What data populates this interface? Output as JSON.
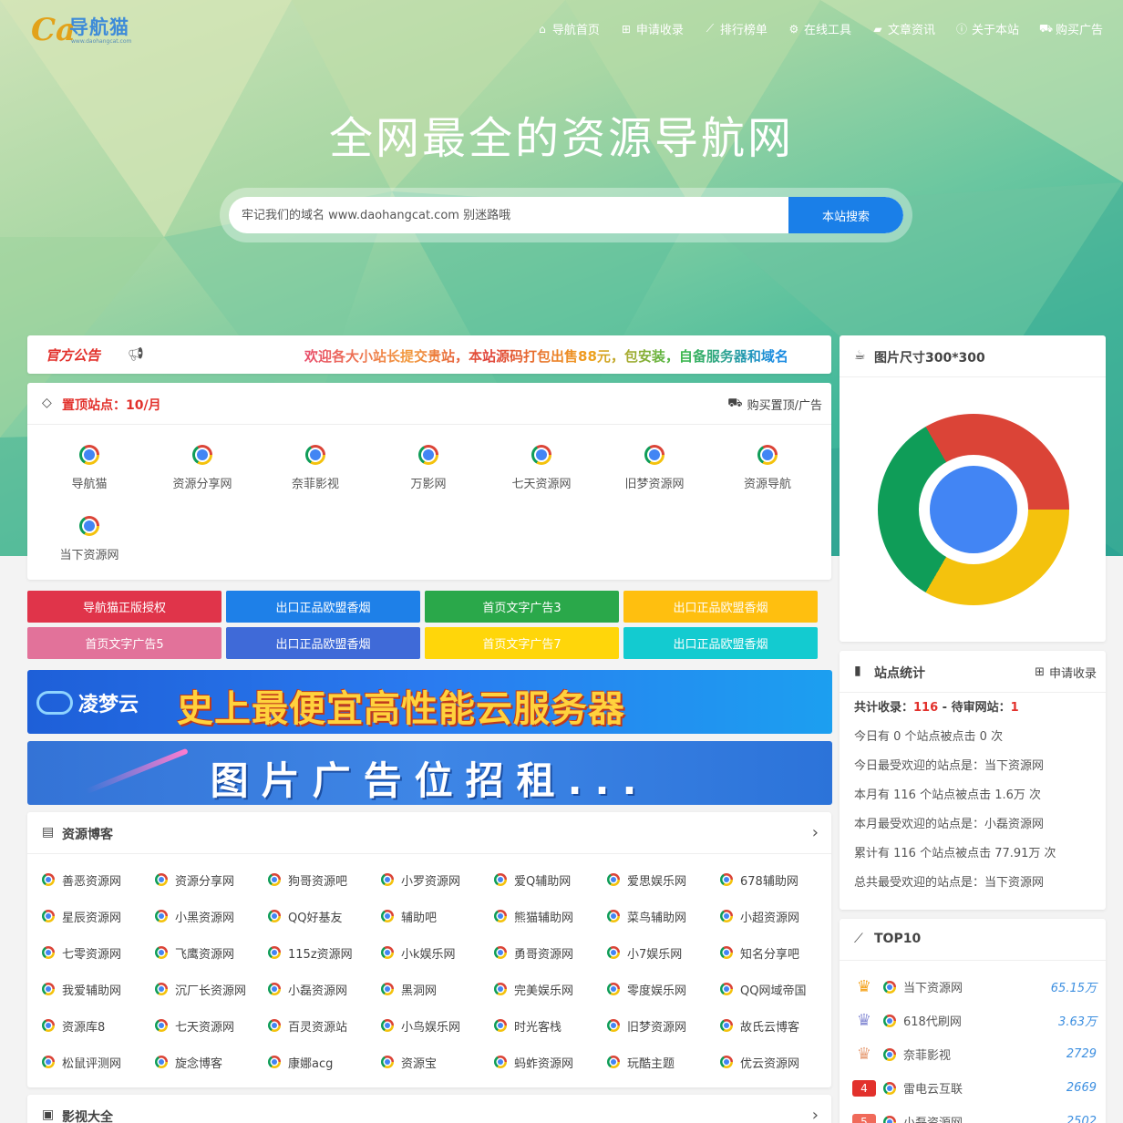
{
  "header": {
    "logo_text": "导航猫",
    "logo_sub": "www.daohangcat.com",
    "nav": [
      {
        "label": "导航首页",
        "icon": "home-icon",
        "glyph": "⌂"
      },
      {
        "label": "申请收录",
        "icon": "plus-square-icon",
        "glyph": "⊞"
      },
      {
        "label": "排行榜单",
        "icon": "line-chart-icon",
        "glyph": "⟋"
      },
      {
        "label": "在线工具",
        "icon": "gears-icon",
        "glyph": "⚙"
      },
      {
        "label": "文章资讯",
        "icon": "folder-open-icon",
        "glyph": "▰"
      },
      {
        "label": "关于本站",
        "icon": "info-circle-icon",
        "glyph": "ⓘ"
      },
      {
        "label": "购买广告",
        "icon": "cart-icon",
        "glyph": "⛟"
      }
    ]
  },
  "hero": {
    "title": "全网最全的资源导航网",
    "search_placeholder": "牢记我们的域名 www.daohangcat.com 别迷路哦",
    "search_button": "本站搜索"
  },
  "notice": {
    "label": "官方公告",
    "text": "欢迎各大小站长提交贵站，本站源码打包出售88元，包安装，自备服务器和域名"
  },
  "pinned": {
    "title": "置顶站点：10/月",
    "buy_label": "购买置顶/广告",
    "items": [
      "导航猫",
      "资源分享网",
      "奈菲影视",
      "万影网",
      "七天资源网",
      "旧梦资源网",
      "资源导航",
      "当下资源网"
    ]
  },
  "text_ads": [
    {
      "label": "导航猫正版授权",
      "color": "#e0344a"
    },
    {
      "label": "出口正品欧盟香烟",
      "color": "#1e80e8"
    },
    {
      "label": "首页文字广告3",
      "color": "#2aa84a"
    },
    {
      "label": "出口正品欧盟香烟",
      "color": "#ffbf0f"
    },
    {
      "label": "首页文字广告5",
      "color": "#e2729a"
    },
    {
      "label": "出口正品欧盟香烟",
      "color": "#3f6ad8"
    },
    {
      "label": "首页文字广告7",
      "color": "#ffd60a"
    },
    {
      "label": "出口正品欧盟香烟",
      "color": "#13cbd0"
    }
  ],
  "banners": {
    "b1_logo": "凌梦云",
    "b1_text": "史上最便宜高性能云服务器",
    "b2_text": "图片广告位招租..."
  },
  "blog": {
    "title": "资源博客",
    "sites": [
      "善恶资源网",
      "资源分享网",
      "狗哥资源吧",
      "小罗资源网",
      "爱Q辅助网",
      "爱思娱乐网",
      "678辅助网",
      "星辰资源网",
      "小黑资源网",
      "QQ好基友",
      "辅助吧",
      "熊猫辅助网",
      "菜鸟辅助网",
      "小超资源网",
      "七零资源网",
      "飞鹰资源网",
      "115z资源网",
      "小k娱乐网",
      "勇哥资源网",
      "小7娱乐网",
      "知名分享吧",
      "我爱辅助网",
      "沉厂长资源网",
      "小磊资源网",
      "黑洞网",
      "完美娱乐网",
      "零度娱乐网",
      "QQ网域帝国",
      "资源库8",
      "七天资源网",
      "百灵资源站",
      "小鸟娱乐网",
      "时光客栈",
      "旧梦资源网",
      "故氏云博客",
      "松鼠评测网",
      "旋念博客",
      "康娜acg",
      "资源宝",
      "蚂蚱资源网",
      "玩酷主题",
      "优云资源网"
    ]
  },
  "video": {
    "title": "影视大全"
  },
  "img_card": {
    "title": "图片尺寸300*300"
  },
  "stats": {
    "title": "站点统计",
    "apply_label": "申请收录",
    "total_label": "共计收录：",
    "total_value": "116",
    "sep": " - ",
    "pending_label": "待审网站：",
    "pending_value": "1",
    "lines": [
      "今日有 0 个站点被点击 0 次",
      "今日最受欢迎的站点是：当下资源网",
      "本月有 116 个站点被点击 1.6万 次",
      "本月最受欢迎的站点是：小磊资源网",
      "累计有 116 个站点被点击 77.91万 次",
      "总共最受欢迎的站点是：当下资源网"
    ]
  },
  "top10": {
    "title": "TOP10",
    "items": [
      {
        "rank": "1",
        "name": "当下资源网",
        "value": "65.15万",
        "color": "#f5a623"
      },
      {
        "rank": "2",
        "name": "618代刷网",
        "value": "3.63万",
        "color": "#8a8fd6"
      },
      {
        "rank": "3",
        "name": "奈菲影视",
        "value": "2729",
        "color": "#e8a27c"
      },
      {
        "rank": "4",
        "name": "雷电云互联",
        "value": "2669",
        "color": "#e2312c"
      },
      {
        "rank": "5",
        "name": "小磊资源网",
        "value": "2502",
        "color": "#f06a5a"
      }
    ]
  }
}
